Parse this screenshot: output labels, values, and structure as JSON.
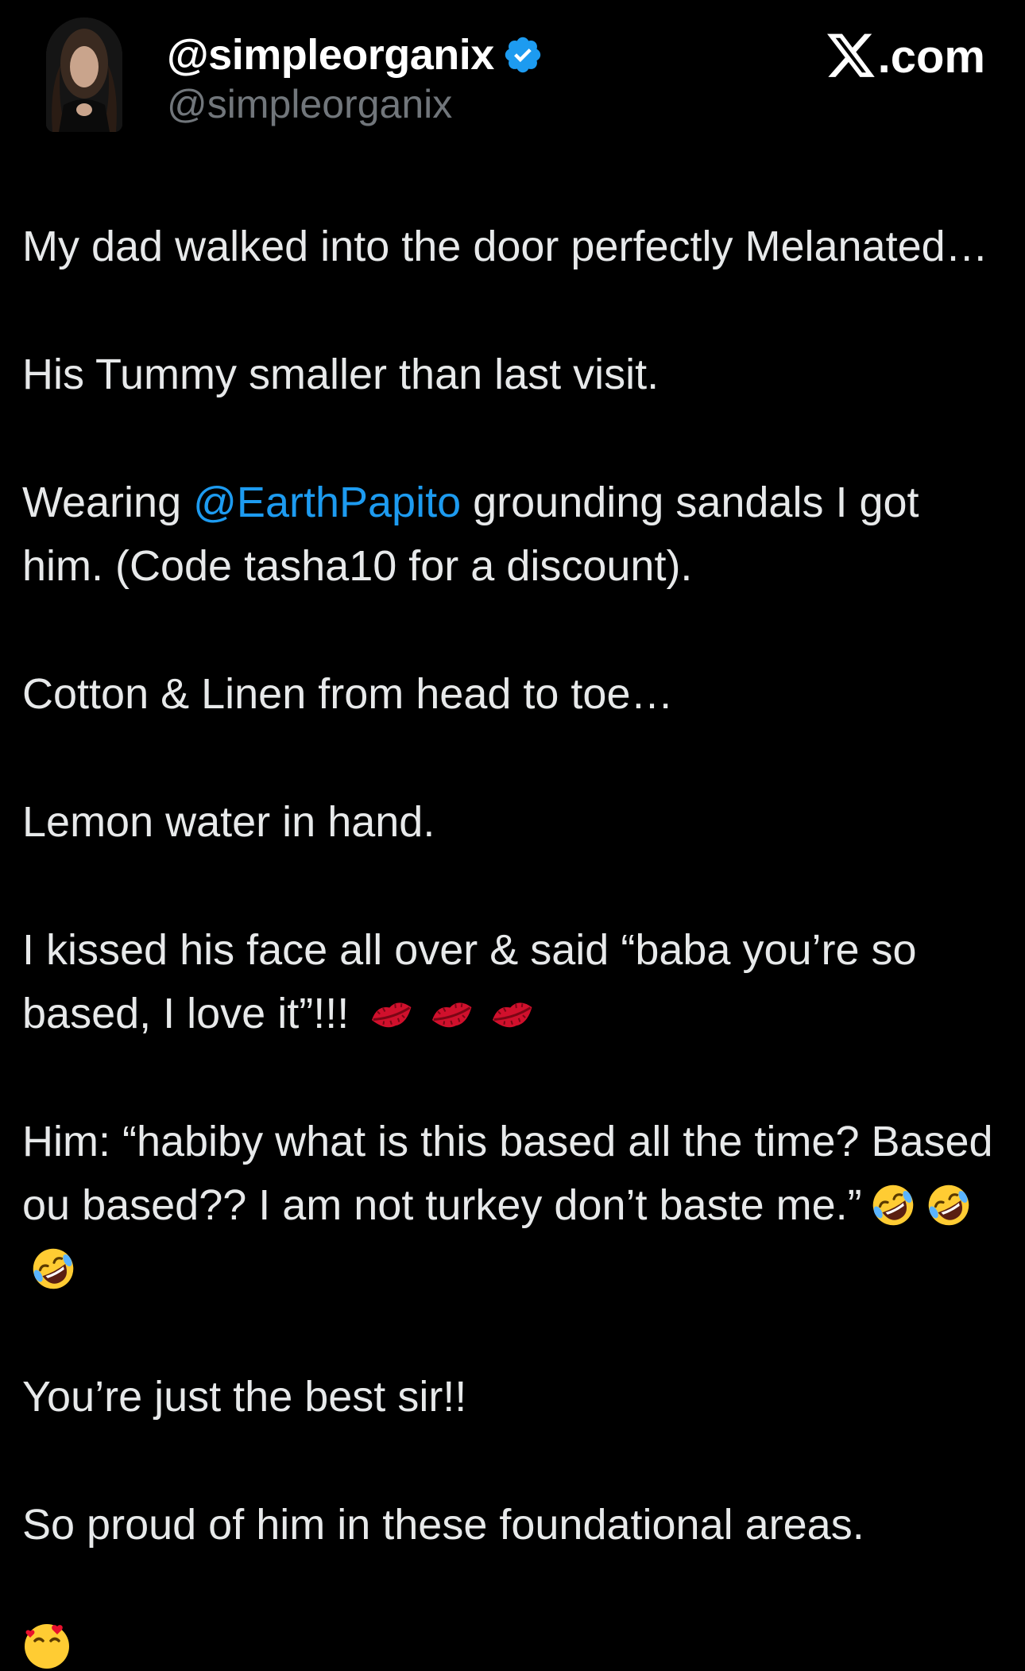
{
  "header": {
    "display_name": "@simpleorganix",
    "handle": "@simpleorganix",
    "site_label": ".com",
    "avatar_icon": "profile-photo",
    "verified_icon": "verified-badge-icon",
    "logo_icon": "x-logo-icon"
  },
  "tweet": {
    "p1": "My dad walked into the door perfectly Melanated…",
    "p2": "His Tummy smaller than last visit.",
    "p3_before": "Wearing ",
    "p3_mention": "@EarthPapito",
    "p3_after": " grounding sandals I got him. (Code tasha10 for a discount).",
    "p4": "Cotton & Linen from head to toe…",
    "p5": "Lemon water in hand.",
    "p6": "I kissed his face all over & said “baba you’re so based, I love it”!!!",
    "p6_emojis": [
      "kiss-mark-icon",
      "kiss-mark-icon",
      "kiss-mark-icon"
    ],
    "p7": "Him: “habiby what is this based all the time? Based ou based?? I am not turkey don’t baste me.”",
    "p7_emojis": [
      "rolling-laughing-icon",
      "rolling-laughing-icon",
      "rolling-laughing-icon"
    ],
    "p8": "You’re just the best sir!!",
    "p9": "So proud of him in these foundational areas.",
    "p9_emoji": "smiling-hearts-icon"
  },
  "colors": {
    "background": "#000000",
    "text": "#e7e9ea",
    "muted": "#71767b",
    "link": "#1d9bf0",
    "verified": "#1d9bf0"
  }
}
